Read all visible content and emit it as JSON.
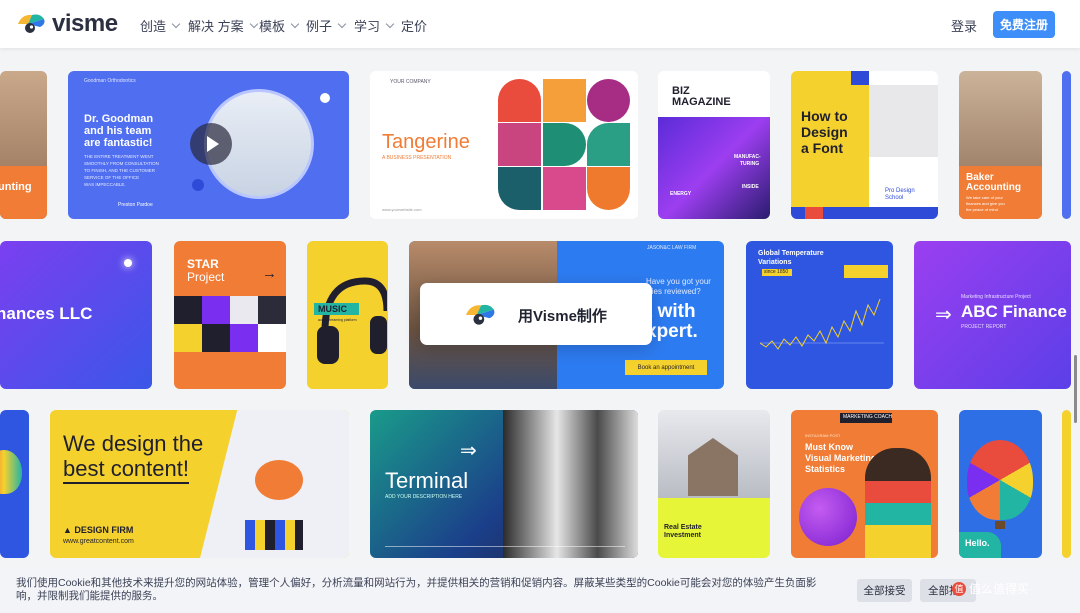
{
  "brand": {
    "name": "visme"
  },
  "nav": {
    "items": [
      {
        "label": "创造"
      },
      {
        "label": "解决 方案"
      },
      {
        "label": "模板"
      },
      {
        "label": "例子"
      },
      {
        "label": "学习"
      },
      {
        "label": "定价"
      }
    ],
    "login": "登录",
    "signup": "免费注册"
  },
  "cards": {
    "c1": "unting",
    "c2": {
      "company": "Goodman Orthodontics",
      "title1": "Dr. Goodman",
      "title2": "and his team",
      "title3": "are fantastic!",
      "body1": "THE ENTIRE TREATMENT WENT",
      "body2": "SMOOTHLY FROM CONSULTATION",
      "body3": "TO FINISH, AND THE CUSTOMER",
      "body4": "SERVICE OF THE OFFICE",
      "body5": "WAS IMPECCABLE.",
      "sign": "Preston Pardoe"
    },
    "c3": {
      "company": "YOUR COMPANY",
      "title": "Tangerine",
      "sub": "A BUSINESS PRESENTATION",
      "url": "www.yourwebsite.com"
    },
    "c4": {
      "title1": "BIZ",
      "title2": "MAGAZINE",
      "k1": "MANUFAC-",
      "k2": "TURING",
      "k3": "ENERGY",
      "k4": "INSIDE"
    },
    "c5": {
      "t1": "How to",
      "t2": "Design",
      "t3": "a Font",
      "s1": "Pro Design",
      "s2": "School"
    },
    "c6": {
      "t1": "Baker",
      "t2": "Accounting",
      "b1": "We take care of your",
      "b2": "finances and give you",
      "b3": "the peace of mind"
    },
    "c7": {
      "t": "nances LLC"
    },
    "c8": {
      "t1": "STAR",
      "t2": "Project"
    },
    "c9": {
      "t": "MUSIC",
      "s": "audio streaming platform"
    },
    "c10": {
      "firm": "JASON&C LAW FIRM",
      "q1": "Have you got your",
      "q2": "icies reviewed?",
      "b1": "t with",
      "b2": "xpert.",
      "btn": "Book an appointment"
    },
    "c11": {
      "t1": "Global Temperature",
      "t2": "Variations",
      "tag": "since 1850"
    },
    "c12": {
      "kicker": "Marketing Infrastructure Project",
      "t": "ABC Finance",
      "sub": "PROJECT REPORT"
    },
    "c13": {
      "t1": "We design the",
      "t2": "best content!",
      "firm": "DESIGN FIRM",
      "url": "www.greatcontent.com"
    },
    "c14": {
      "t": "Terminal",
      "s": "ADD YOUR DESCRIPTION HERE"
    },
    "c15": {
      "t1": "Real Estate",
      "t2": "Investment"
    },
    "c16": {
      "tag": "MARKETING COACH",
      "k": "INSTAGRAM POST",
      "t1": "Must Know",
      "t2": "Visual Marketing",
      "t3": "Statistics"
    },
    "c17": {
      "t": "Hello."
    }
  },
  "cta": {
    "label": "用Visme制作"
  },
  "cookie": {
    "message": "我们使用Cookie和其他技术来提升您的网站体验，管理个人偏好，分析流量和网站行为，并提供相关的营销和促销内容。屏蔽某些类型的Cookie可能会对您的体验产生负面影响，并限制我们能提供的服务。",
    "accept": "全部接受",
    "reject": "全部拒",
    "watermark": "值么值得买"
  },
  "colors": {
    "accent": "#3d8ef8",
    "nav_text": "#3c4257"
  }
}
